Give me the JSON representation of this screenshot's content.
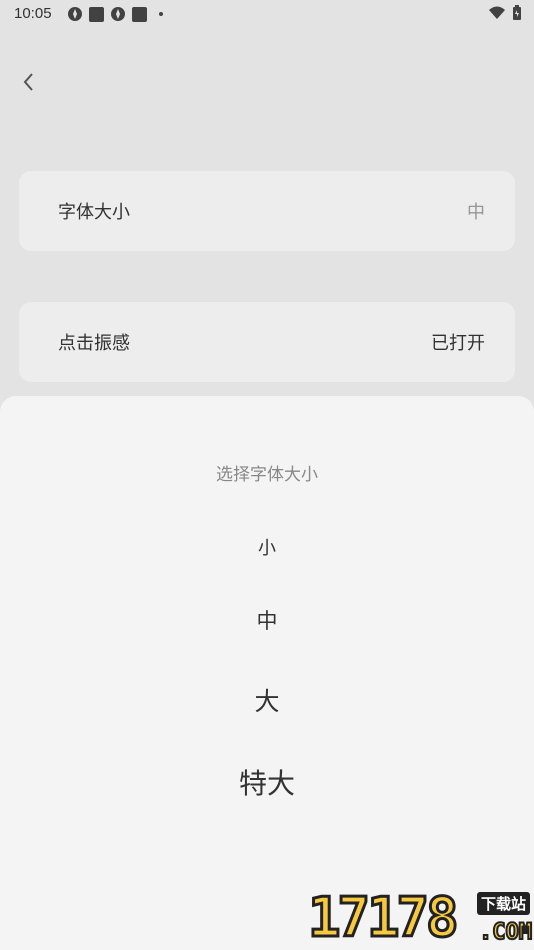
{
  "status_bar": {
    "time": "10:05"
  },
  "settings": {
    "font_size": {
      "label": "字体大小",
      "value": "中"
    },
    "haptic": {
      "label": "点击振感",
      "value": "已打开"
    }
  },
  "sheet": {
    "title": "选择字体大小",
    "options": [
      "小",
      "中",
      "大",
      "特大"
    ]
  },
  "watermark": {
    "digits": "17178",
    "tag": "下载站",
    "suffix": ".COM"
  }
}
